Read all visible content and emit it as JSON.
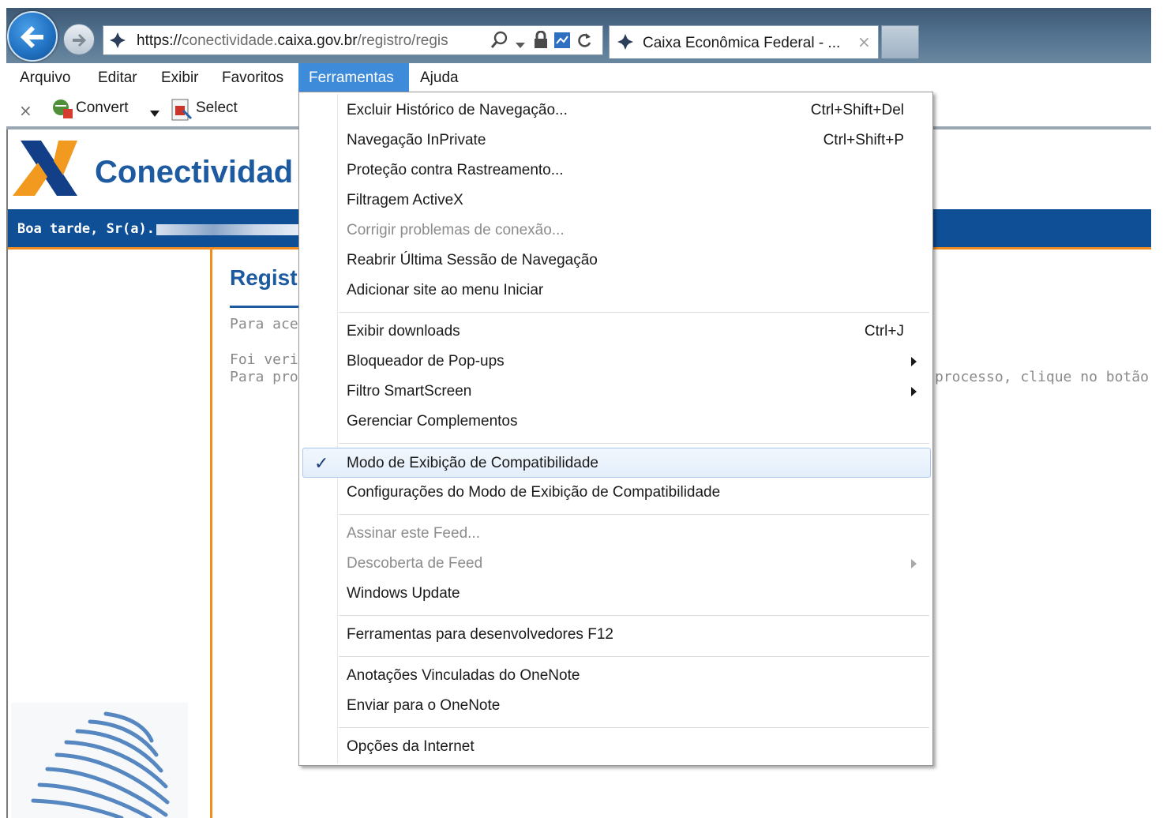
{
  "browser": {
    "url_scheme": "https://",
    "url_host_start": "conectividade.",
    "url_host_bold": "caixa.gov.br",
    "url_path": "/registro/regis",
    "tab_title": "Caixa Econômica Federal - ...",
    "tab_close": "×"
  },
  "menubar": {
    "items": [
      {
        "label": "Arquivo"
      },
      {
        "label": "Editar"
      },
      {
        "label": "Exibir"
      },
      {
        "label": "Favoritos"
      },
      {
        "label": "Ferramentas"
      },
      {
        "label": "Ajuda"
      }
    ]
  },
  "commandbar": {
    "close_glyph": "×",
    "convert_label": "Convert",
    "select_label": "Select"
  },
  "page": {
    "brand": "Conectividad",
    "greeting": "Boa tarde, Sr(a).",
    "section_title": "Regist",
    "line1": "Para ace",
    "line2": "Foi verifi",
    "line3": "Para pro",
    "line3_right": "processo, clique no botão 'C"
  },
  "dropdown": {
    "items": [
      {
        "label": "Excluir Histórico de Navegação...",
        "shortcut": "Ctrl+Shift+Del"
      },
      {
        "label": "Navegação InPrivate",
        "shortcut": "Ctrl+Shift+P"
      },
      {
        "label": "Proteção contra Rastreamento..."
      },
      {
        "label": "Filtragem ActiveX"
      },
      {
        "label": "Corrigir problemas de conexão...",
        "disabled": true
      },
      {
        "label": "Reabrir Última Sessão de Navegação"
      },
      {
        "label": "Adicionar site ao menu Iniciar"
      },
      {
        "label": "Exibir downloads",
        "shortcut": "Ctrl+J"
      },
      {
        "label": "Bloqueador de Pop-ups",
        "submenu": true
      },
      {
        "label": "Filtro SmartScreen",
        "submenu": true
      },
      {
        "label": "Gerenciar Complementos"
      },
      {
        "label": "Modo de Exibição de Compatibilidade",
        "checked": true,
        "check_glyph": "✓"
      },
      {
        "label": "Configurações do Modo de Exibição de Compatibilidade"
      },
      {
        "label": "Assinar este Feed...",
        "disabled": true
      },
      {
        "label": "Descoberta de Feed",
        "disabled": true,
        "submenu": true
      },
      {
        "label": "Windows Update"
      },
      {
        "label": "Ferramentas para desenvolvedores F12"
      },
      {
        "label": "Anotações Vinculadas do OneNote"
      },
      {
        "label": "Enviar para o OneNote"
      },
      {
        "label": "Opções da Internet"
      }
    ]
  },
  "colors": {
    "menu_active": "#3d8bd9",
    "caixa_blue": "#0e4f95",
    "caixa_orange": "#f28c1e",
    "brand_text": "#1d5aa0"
  }
}
